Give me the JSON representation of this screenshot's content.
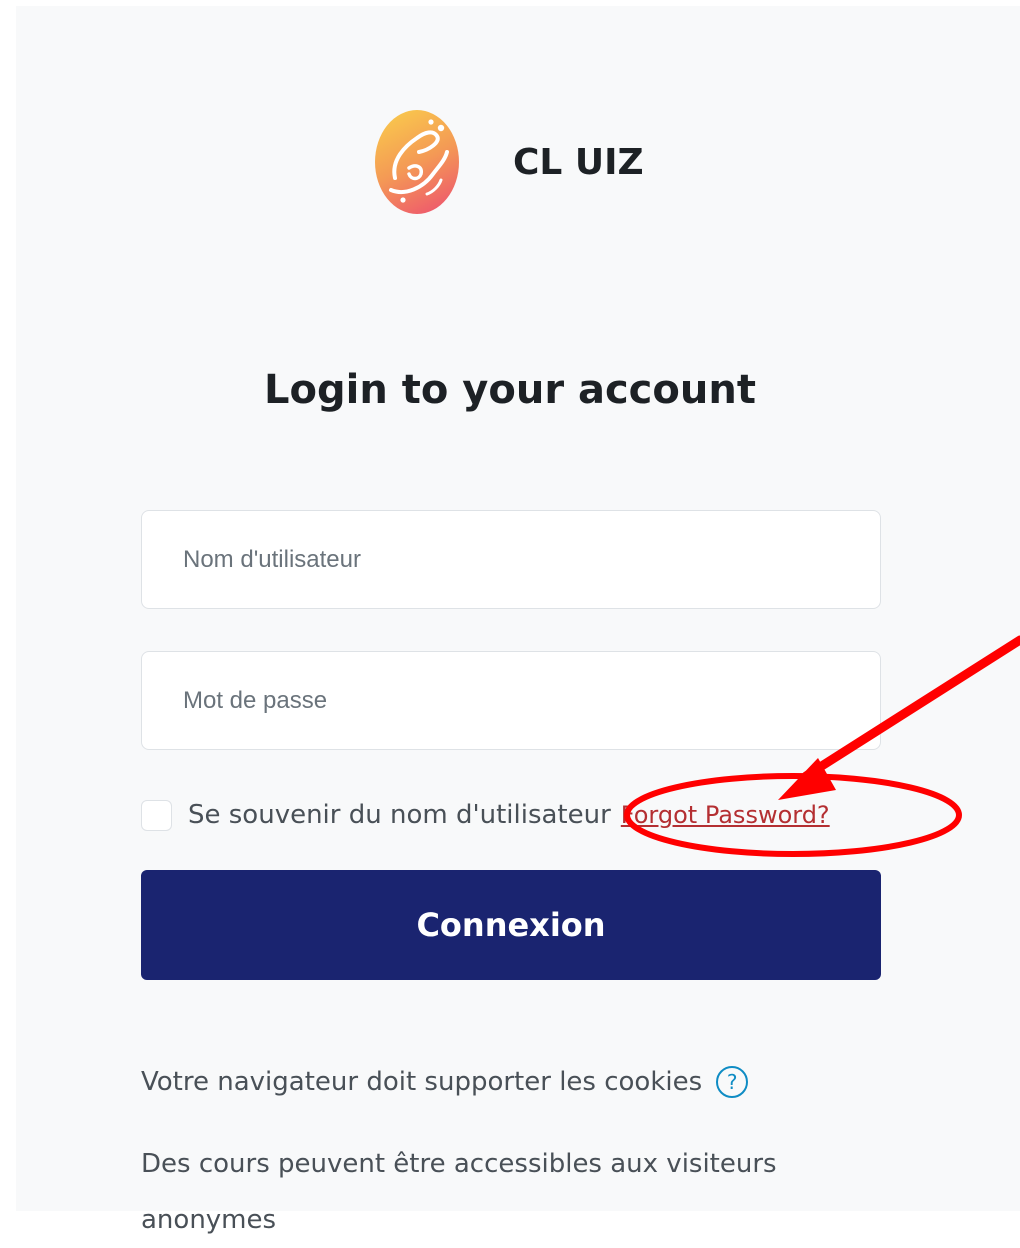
{
  "brand": {
    "name": "CL UIZ",
    "logo_icon": "calligraphy-logo-icon",
    "logo_colors": [
      "#f7b54a",
      "#f06b66"
    ]
  },
  "login": {
    "title": "Login to your account"
  },
  "form": {
    "username_placeholder": "Nom d'utilisateur",
    "password_placeholder": "Mot de passe",
    "remember_label": "Se souvenir du nom d'utilisateur",
    "forgot_link": "Forgot Password?",
    "submit_label": "Connexion"
  },
  "info": {
    "cookies_text": "Votre navigateur doit supporter les cookies",
    "help_icon": "question-circle-icon",
    "guest_text": "Des cours peuvent être accessibles aux visiteurs anonymes"
  },
  "annotation": {
    "color": "#ff0000",
    "shapes": [
      "arrow",
      "ellipse"
    ]
  },
  "colors": {
    "primary": "#1a2470",
    "link": "#b42f32",
    "text": "#1d2125",
    "muted": "#495057",
    "info": "#0f8cc4"
  }
}
